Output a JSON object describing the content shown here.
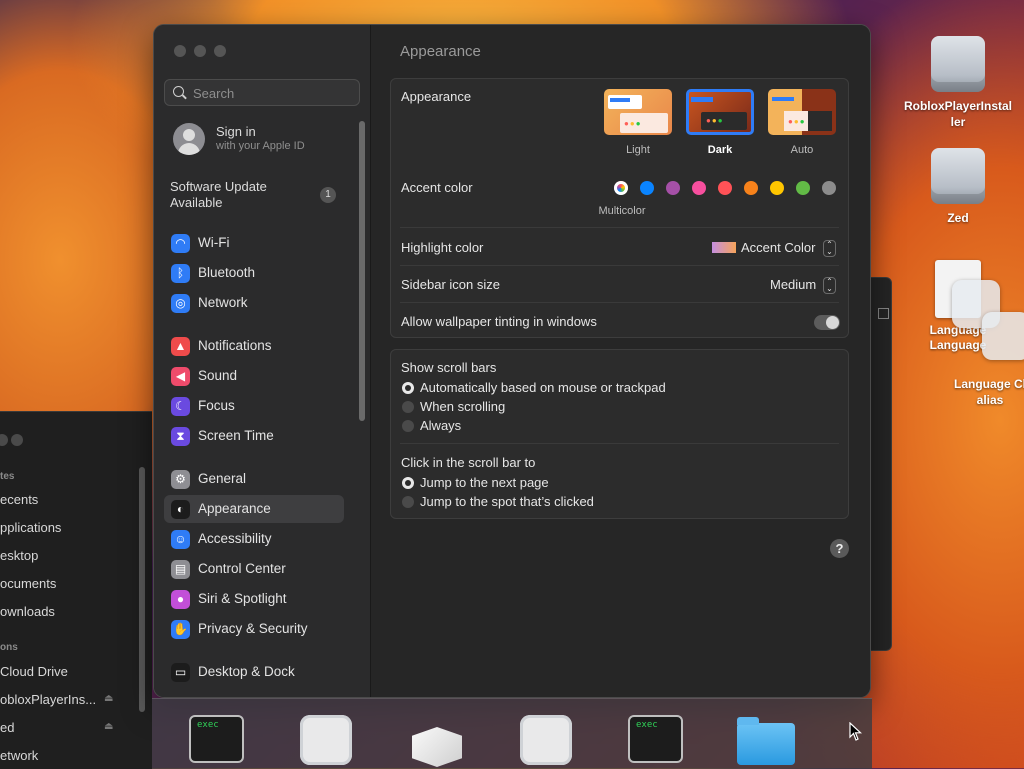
{
  "desktop": {
    "icons": [
      {
        "label": "RobloxPlayerInstaller"
      },
      {
        "label": "Zed"
      },
      {
        "label": "Language"
      },
      {
        "label": "Language"
      },
      {
        "label": "Language Cl alias"
      }
    ]
  },
  "finder_sidebar": {
    "sections": [
      {
        "header": "tes",
        "items": [
          "ecents",
          "pplications",
          "esktop",
          "ocuments",
          "ownloads"
        ]
      },
      {
        "header": "ons",
        "items": [
          "Cloud Drive",
          "obloxPlayerIns...",
          "ed",
          "etwork"
        ]
      }
    ]
  },
  "settings": {
    "search_placeholder": "Search",
    "account": {
      "title": "Sign in",
      "subtitle": "with your Apple ID"
    },
    "software_update": {
      "label": "Software Update Available",
      "count": "1"
    },
    "sidebar_items": [
      {
        "label": "Wi-Fi",
        "icon": "wifi-icon",
        "color": "#2f7cf6",
        "glyph": "◠"
      },
      {
        "label": "Bluetooth",
        "icon": "bluetooth-icon",
        "color": "#2f7cf6",
        "glyph": "ᛒ"
      },
      {
        "label": "Network",
        "icon": "globe-icon",
        "color": "#2f7cf6",
        "glyph": "◎"
      },
      {
        "label": "Notifications",
        "icon": "bell-icon",
        "color": "#ef4b4b",
        "glyph": "▲"
      },
      {
        "label": "Sound",
        "icon": "speaker-icon",
        "color": "#ef4b6b",
        "glyph": "◀"
      },
      {
        "label": "Focus",
        "icon": "moon-icon",
        "color": "#6a4ae0",
        "glyph": "☾"
      },
      {
        "label": "Screen Time",
        "icon": "hourglass-icon",
        "color": "#6a4ae0",
        "glyph": "⧗"
      },
      {
        "label": "General",
        "icon": "gear-icon",
        "color": "#8e8e93",
        "glyph": "⚙"
      },
      {
        "label": "Appearance",
        "icon": "appearance-icon",
        "color": "#1c1c1c",
        "glyph": "◐"
      },
      {
        "label": "Accessibility",
        "icon": "accessibility-icon",
        "color": "#2f7cf6",
        "glyph": "☺"
      },
      {
        "label": "Control Center",
        "icon": "control-center-icon",
        "color": "#8e8e93",
        "glyph": "▤"
      },
      {
        "label": "Siri & Spotlight",
        "icon": "siri-icon",
        "color": "#c24fd8",
        "glyph": "●"
      },
      {
        "label": "Privacy & Security",
        "icon": "hand-icon",
        "color": "#2f7cf6",
        "glyph": "✋"
      },
      {
        "label": "Desktop & Dock",
        "icon": "dock-icon",
        "color": "#1c1c1c",
        "glyph": "▭"
      }
    ],
    "selected": "Appearance",
    "content_title": "Appearance",
    "appearance": {
      "label": "Appearance",
      "options": [
        {
          "caption": "Light",
          "selected": false
        },
        {
          "caption": "Dark",
          "selected": true
        },
        {
          "caption": "Auto",
          "selected": false
        }
      ]
    },
    "accent": {
      "label": "Accent color",
      "caption": "Multicolor",
      "colors": [
        "#ffffff",
        "#0a84ff",
        "#a550a7",
        "#f74f9e",
        "#ff5257",
        "#f7821b",
        "#ffc600",
        "#62ba46",
        "#8c8c8c"
      ]
    },
    "highlight": {
      "label": "Highlight color",
      "value": "Accent Color"
    },
    "icon_size": {
      "label": "Sidebar icon size",
      "value": "Medium"
    },
    "tinting": {
      "label": "Allow wallpaper tinting in windows",
      "enabled": false
    },
    "scroll_bars": {
      "label": "Show scroll bars",
      "options": [
        "Automatically based on mouse or trackpad",
        "When scrolling",
        "Always"
      ],
      "selected": 0
    },
    "click_scroll": {
      "label": "Click in the scroll bar to",
      "options": [
        "Jump to the next page",
        "Jump to the spot that’s clicked"
      ],
      "selected": 0
    },
    "help": "?"
  },
  "dock": {
    "apps": [
      {
        "name": "terminal-exec-1",
        "text": "exec"
      },
      {
        "name": "generic-app-1",
        "text": ""
      },
      {
        "name": "lego-app",
        "text": ""
      },
      {
        "name": "generic-app-2",
        "text": ""
      },
      {
        "name": "terminal-exec-2",
        "text": "exec"
      },
      {
        "name": "folder",
        "text": ""
      }
    ]
  }
}
